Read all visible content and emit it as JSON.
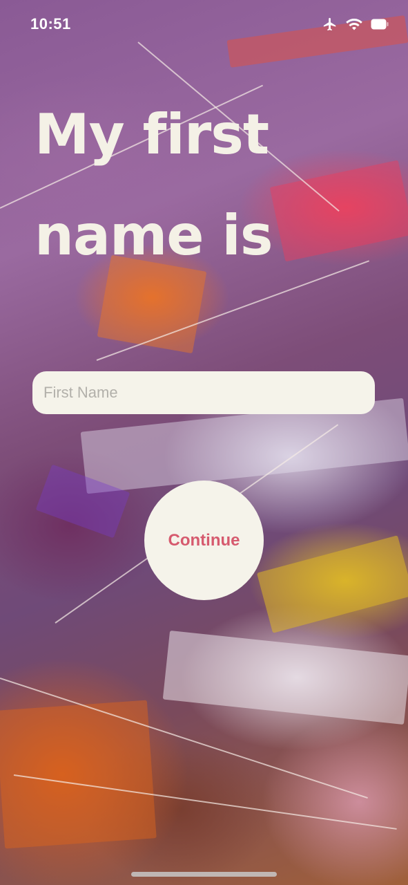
{
  "status_bar": {
    "time": "10:51",
    "icons": [
      "airplane-icon",
      "wifi-icon",
      "battery-icon"
    ]
  },
  "heading": {
    "line1": "My first",
    "line2": "name is"
  },
  "first_name_input": {
    "value": "",
    "placeholder": "First Name"
  },
  "continue_button": {
    "label": "Continue"
  },
  "colors": {
    "heading_text": "#f4f1e6",
    "surface": "#f5f3ea",
    "button_text": "#d65a6e",
    "placeholder_text": "#b2b0aa"
  }
}
